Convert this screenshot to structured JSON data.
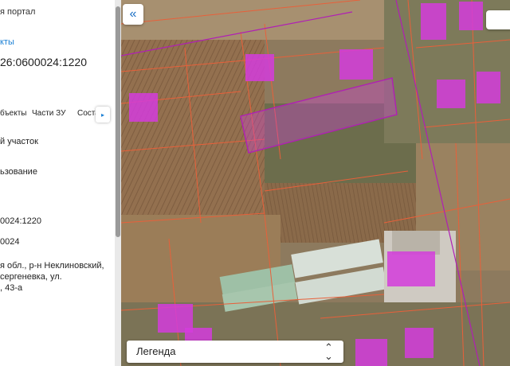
{
  "panel": {
    "title": "я портал",
    "link": "кты",
    "cadastral_number": "26:0600024:1220",
    "tabs": [
      {
        "label": "бъекты"
      },
      {
        "label": "Части ЗУ"
      },
      {
        "label": "Соста"
      }
    ],
    "tab_scroll_icon": "▸",
    "object_type": "й участок",
    "permitted_use": "ьзование",
    "short_number": "0024:1220",
    "quarter": "0024",
    "address": [
      "я обл., р-н Неклиновский,",
      "сергеневка, ул.",
      ", 43-а"
    ]
  },
  "map": {
    "collapse_icon": "«",
    "legend_label": "Легенда",
    "legend_chevron_up": "⌃",
    "legend_chevron_down": "⌄",
    "colors": {
      "parcel_fill": "#d43cdc",
      "boundary": "#e8603a",
      "selected_outline": "#b01fb5"
    }
  }
}
